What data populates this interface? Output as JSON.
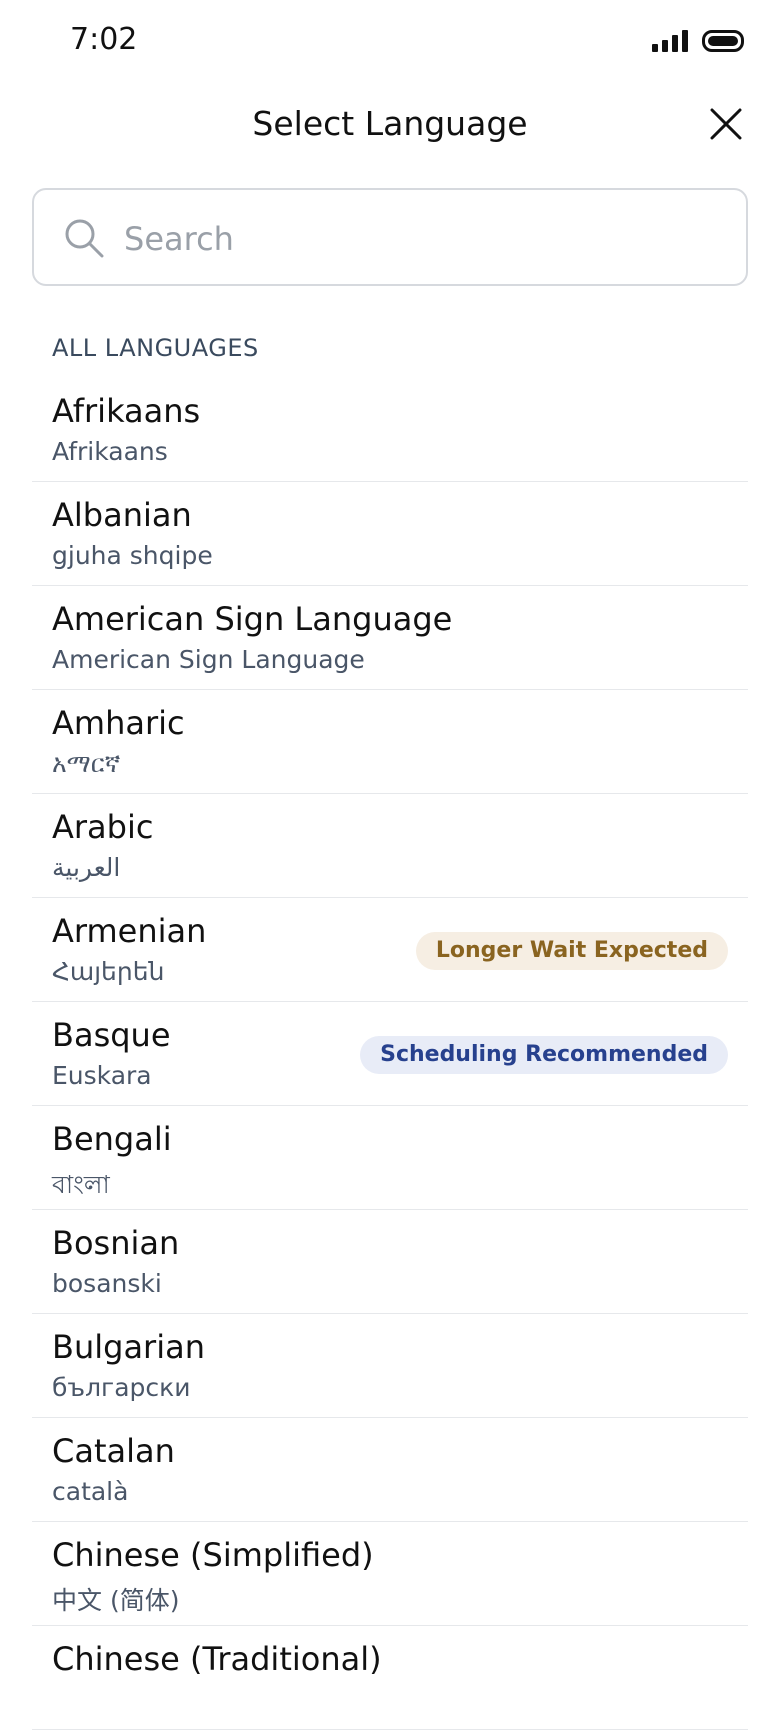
{
  "status_bar": {
    "time": "7:02",
    "signal_icon": "cellular-signal-icon",
    "battery_icon": "battery-icon"
  },
  "header": {
    "title": "Select Language",
    "close_icon": "close-icon"
  },
  "search": {
    "placeholder": "Search",
    "value": "",
    "icon": "search-icon"
  },
  "section": {
    "label": "ALL LANGUAGES"
  },
  "colors": {
    "text_primary": "#111418",
    "text_secondary": "#4a5668",
    "section_label": "#3a4a5e",
    "badge_wait_bg": "#f6eee3",
    "badge_wait_text": "#8a6420",
    "badge_schedule_bg": "#e8ecf7",
    "badge_schedule_text": "#27418e",
    "divider": "#e6e8eb"
  },
  "languages": [
    {
      "name": "Afrikaans",
      "native": "Afrikaans"
    },
    {
      "name": "Albanian",
      "native": "gjuha shqipe"
    },
    {
      "name": "American Sign Language",
      "native": "American Sign Language"
    },
    {
      "name": "Amharic",
      "native": "አማርኛ"
    },
    {
      "name": "Arabic",
      "native": "العربية"
    },
    {
      "name": "Armenian",
      "native": "Հայերեն",
      "badge": {
        "label": "Longer Wait Expected",
        "type": "wait"
      }
    },
    {
      "name": "Basque",
      "native": "Euskara",
      "badge": {
        "label": "Scheduling Recommended",
        "type": "schedule"
      }
    },
    {
      "name": "Bengali",
      "native": "বাংলা"
    },
    {
      "name": "Bosnian",
      "native": "bosanski"
    },
    {
      "name": "Bulgarian",
      "native": "български"
    },
    {
      "name": "Catalan",
      "native": "català"
    },
    {
      "name": "Chinese (Simplified)",
      "native": "中文 (简体)"
    },
    {
      "name": "Chinese (Traditional)",
      "native": ""
    }
  ]
}
